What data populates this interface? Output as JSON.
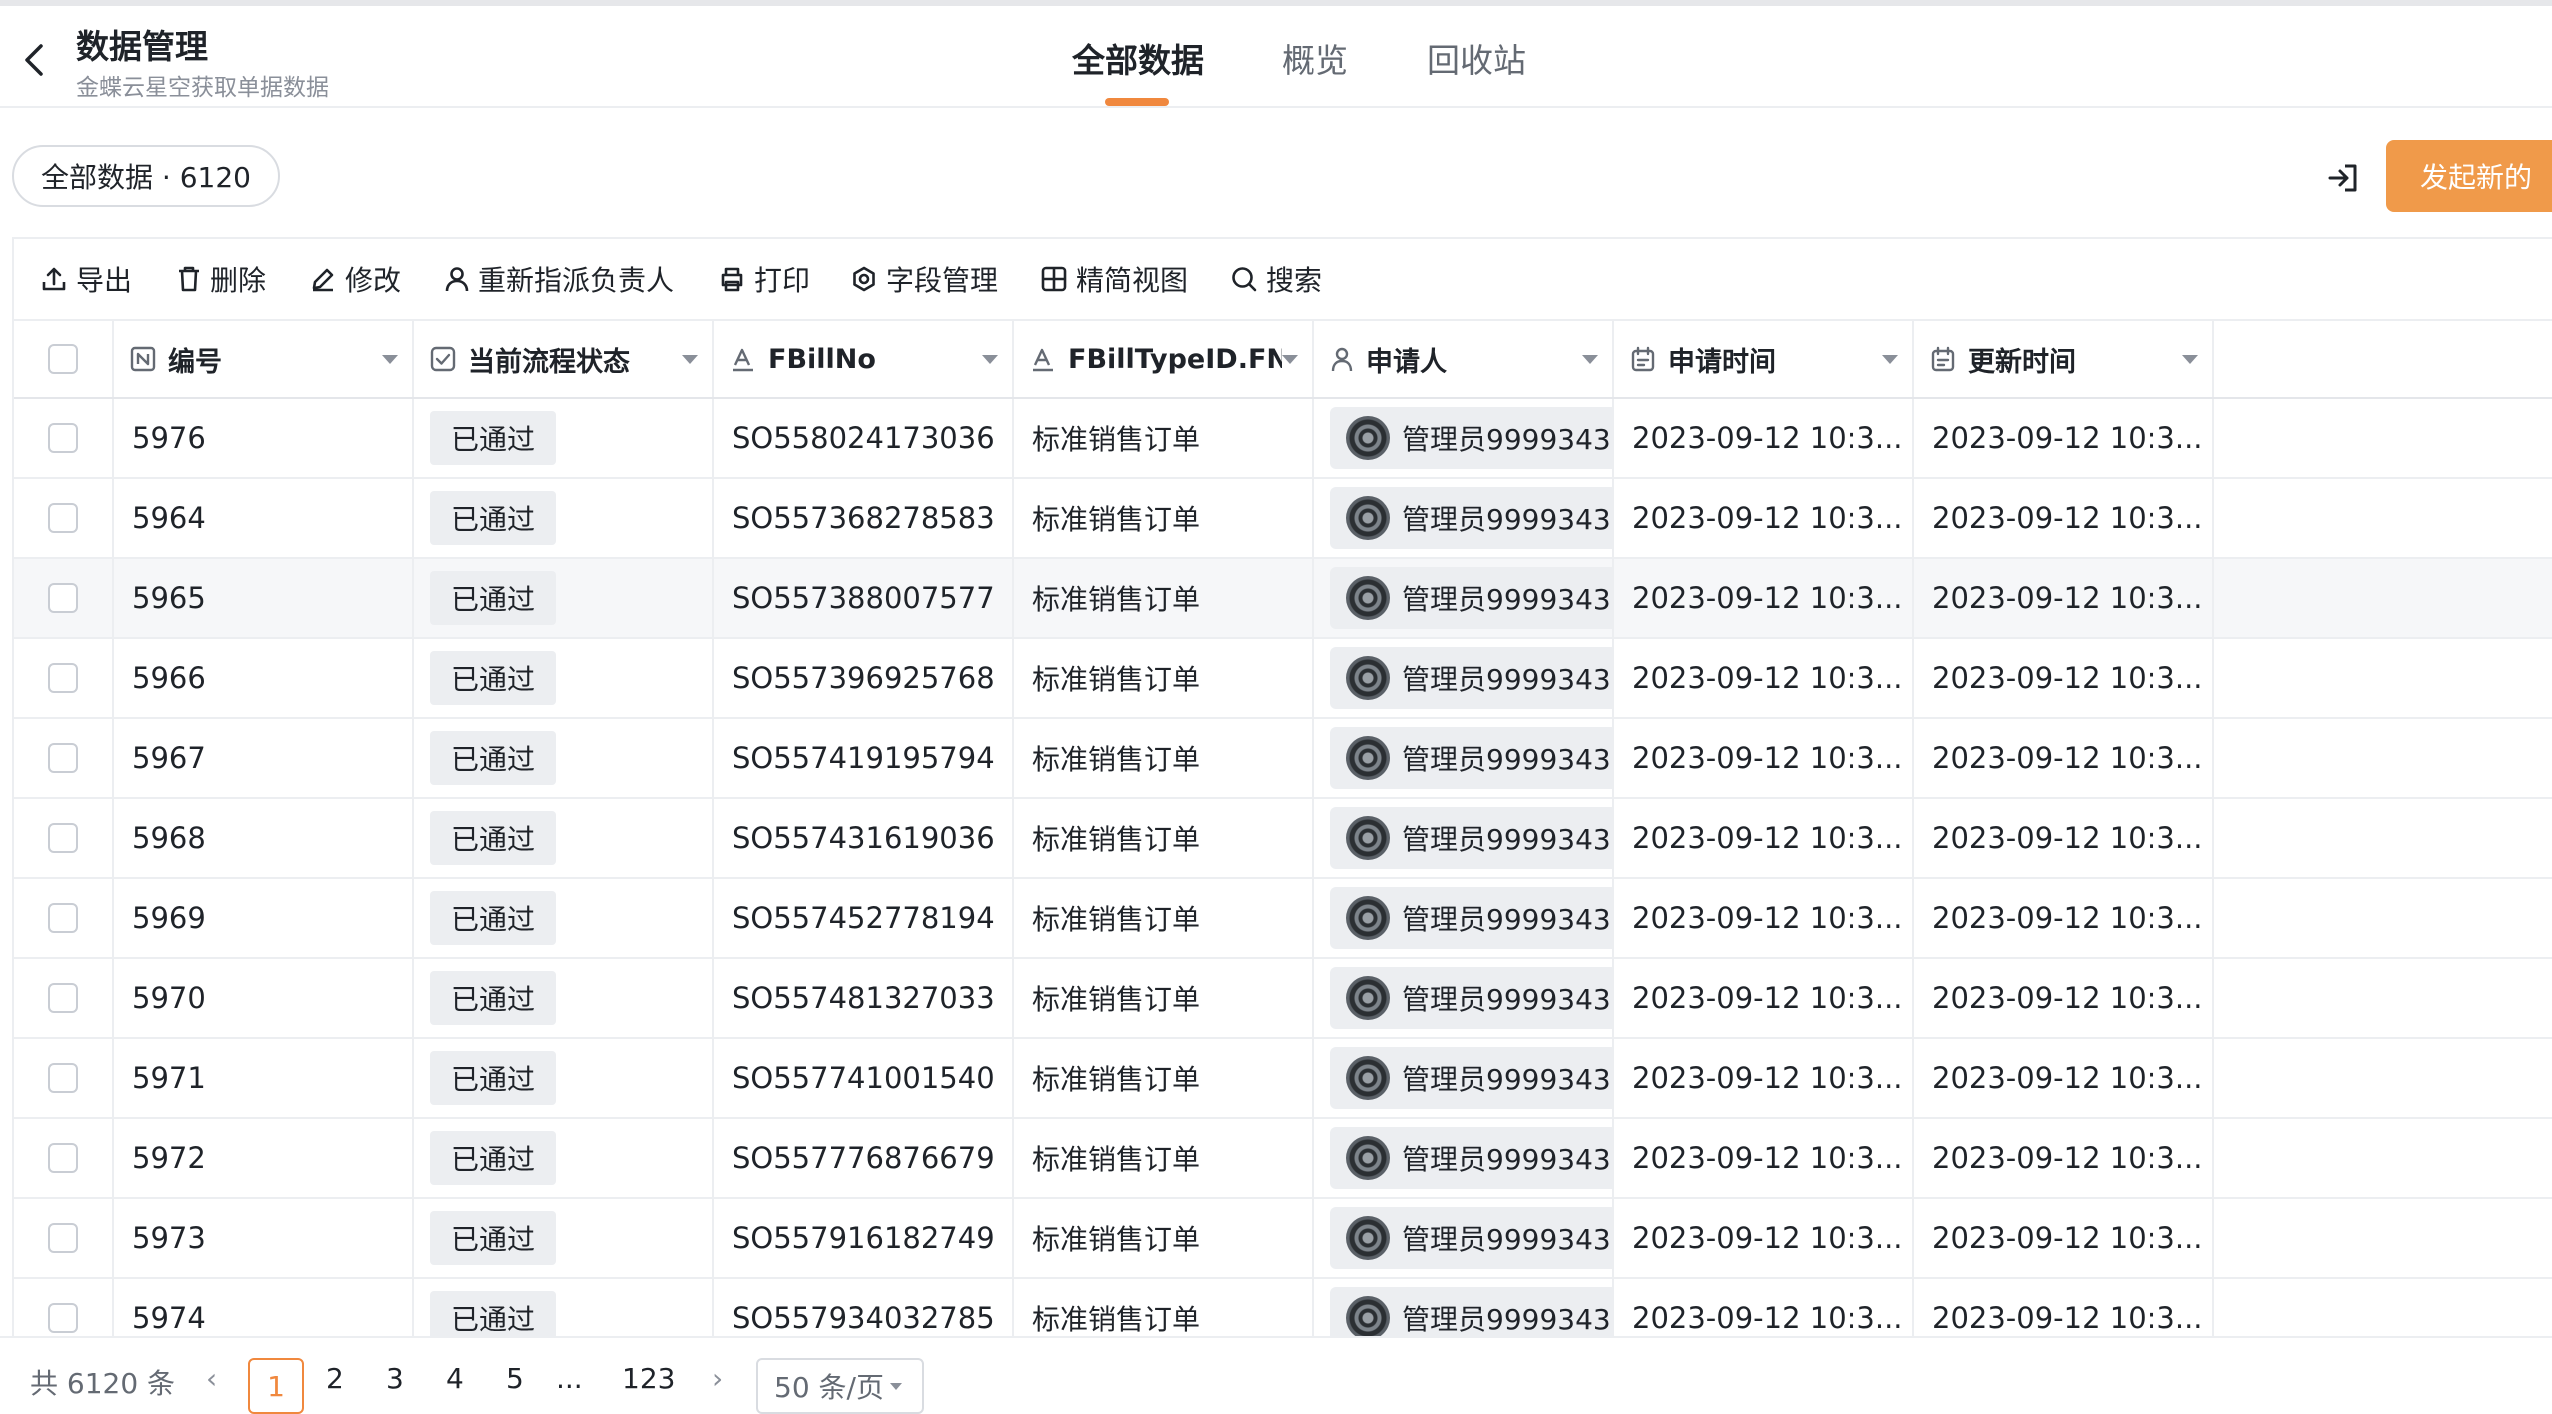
{
  "header": {
    "title": "数据管理",
    "subtitle": "金蝶云星空获取单据数据",
    "tabs": [
      {
        "label": "全部数据",
        "active": true
      },
      {
        "label": "概览",
        "active": false
      },
      {
        "label": "回收站",
        "active": false
      }
    ]
  },
  "view": {
    "pill_label": "全部数据 · 6120",
    "new_button": "发起新的"
  },
  "actions": [
    {
      "label": "导出",
      "icon": "upload-icon"
    },
    {
      "label": "删除",
      "icon": "trash-icon"
    },
    {
      "label": "修改",
      "icon": "pencil-icon"
    },
    {
      "label": "重新指派负责人",
      "icon": "person-icon"
    },
    {
      "label": "打印",
      "icon": "printer-icon"
    },
    {
      "label": "字段管理",
      "icon": "gear-icon"
    },
    {
      "label": "精简视图",
      "icon": "grid-icon"
    },
    {
      "label": "搜索",
      "icon": "search-icon"
    }
  ],
  "table": {
    "columns": [
      {
        "label": "编号",
        "icon": "number-field-icon"
      },
      {
        "label": "当前流程状态",
        "icon": "status-field-icon"
      },
      {
        "label": "FBillNo",
        "icon": "text-field-icon"
      },
      {
        "label": "FBillTypeID.FN",
        "icon": "text-field-icon"
      },
      {
        "label": "申请人",
        "icon": "person-field-icon"
      },
      {
        "label": "申请时间",
        "icon": "calendar-icon"
      },
      {
        "label": "更新时间",
        "icon": "calendar-icon"
      }
    ],
    "rows": [
      {
        "id": "5976",
        "status": "已通过",
        "bill_no": "SO558024173036",
        "bill_type": "标准销售订单",
        "applicant": "管理员9999343",
        "applied": "2023-09-12 10:3...",
        "updated": "2023-09-12 10:3..."
      },
      {
        "id": "5964",
        "status": "已通过",
        "bill_no": "SO557368278583",
        "bill_type": "标准销售订单",
        "applicant": "管理员9999343",
        "applied": "2023-09-12 10:3...",
        "updated": "2023-09-12 10:3..."
      },
      {
        "id": "5965",
        "status": "已通过",
        "bill_no": "SO557388007577",
        "bill_type": "标准销售订单",
        "applicant": "管理员9999343",
        "applied": "2023-09-12 10:3...",
        "updated": "2023-09-12 10:3..."
      },
      {
        "id": "5966",
        "status": "已通过",
        "bill_no": "SO557396925768",
        "bill_type": "标准销售订单",
        "applicant": "管理员9999343",
        "applied": "2023-09-12 10:3...",
        "updated": "2023-09-12 10:3..."
      },
      {
        "id": "5967",
        "status": "已通过",
        "bill_no": "SO557419195794",
        "bill_type": "标准销售订单",
        "applicant": "管理员9999343",
        "applied": "2023-09-12 10:3...",
        "updated": "2023-09-12 10:3..."
      },
      {
        "id": "5968",
        "status": "已通过",
        "bill_no": "SO557431619036",
        "bill_type": "标准销售订单",
        "applicant": "管理员9999343",
        "applied": "2023-09-12 10:3...",
        "updated": "2023-09-12 10:3..."
      },
      {
        "id": "5969",
        "status": "已通过",
        "bill_no": "SO557452778194",
        "bill_type": "标准销售订单",
        "applicant": "管理员9999343",
        "applied": "2023-09-12 10:3...",
        "updated": "2023-09-12 10:3..."
      },
      {
        "id": "5970",
        "status": "已通过",
        "bill_no": "SO557481327033",
        "bill_type": "标准销售订单",
        "applicant": "管理员9999343",
        "applied": "2023-09-12 10:3...",
        "updated": "2023-09-12 10:3..."
      },
      {
        "id": "5971",
        "status": "已通过",
        "bill_no": "SO557741001540",
        "bill_type": "标准销售订单",
        "applicant": "管理员9999343",
        "applied": "2023-09-12 10:3...",
        "updated": "2023-09-12 10:3..."
      },
      {
        "id": "5972",
        "status": "已通过",
        "bill_no": "SO557776876679",
        "bill_type": "标准销售订单",
        "applicant": "管理员9999343",
        "applied": "2023-09-12 10:3...",
        "updated": "2023-09-12 10:3..."
      },
      {
        "id": "5973",
        "status": "已通过",
        "bill_no": "SO557916182749",
        "bill_type": "标准销售订单",
        "applicant": "管理员9999343",
        "applied": "2023-09-12 10:3...",
        "updated": "2023-09-12 10:3..."
      },
      {
        "id": "5974",
        "status": "已通过",
        "bill_no": "SO557934032785",
        "bill_type": "标准销售订单",
        "applicant": "管理员9999343",
        "applied": "2023-09-12 10:3...",
        "updated": "2023-09-12 10:3..."
      }
    ]
  },
  "pagination": {
    "total": "共 6120 条",
    "prev": "‹",
    "pages": [
      "1",
      "2",
      "3",
      "4",
      "5",
      "...",
      "123"
    ],
    "current": "1",
    "next": "›",
    "page_size": "50 条/页"
  },
  "colors": {
    "accent": "#f0883e",
    "primary_button": "#f09a4a"
  }
}
